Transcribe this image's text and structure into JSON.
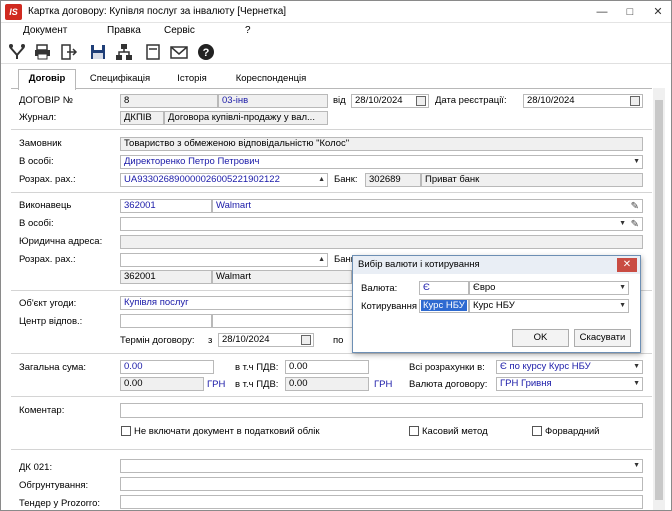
{
  "window": {
    "title": "Картка договору:  Купівля послуг за інвалюту [Чернетка]"
  },
  "menu": [
    "Документ",
    "Правка",
    "Сервіс",
    "?"
  ],
  "tabs": [
    "Договір",
    "Специфікація",
    "Історія",
    "Кореспонденція"
  ],
  "contract": {
    "label_no": "ДОГОВІР №",
    "number": "8",
    "date_text": "03-інв",
    "label_from": "від",
    "date": "28/10/2024",
    "label_reg": "Дата реєстрації:",
    "reg_date": "28/10/2024",
    "label_journal": "Журнал:",
    "journal_code": "ДКПІВ",
    "journal_name": "Договора купівлі-продажу у вал..."
  },
  "customer": {
    "label": "Замовник",
    "name": "Товариство з обмеженою відповідальністю \"Колос\"",
    "label_person": "В особі:",
    "person": "Директоренко Петро Петрович",
    "label_account": "Розрах. рах.:",
    "account": "UA933026890000026005221902122",
    "label_bank": "Банк:",
    "bank_code": "302689",
    "bank_name": "Приват банк"
  },
  "executor": {
    "label": "Виконавець",
    "code": "362001",
    "name": "Walmart",
    "label_person": "В особі:",
    "label_address": "Юридична адреса:",
    "label_account": "Розрах. рах.:",
    "label_bank": "Банк",
    "bank_code": "362001",
    "bank_name": "Walmart"
  },
  "subject": {
    "label": "Об'єкт угоди:",
    "value": "Купівля послуг",
    "label_center": "Центр відпов.:",
    "label_term": "Термін договору:",
    "label_term_from": "з",
    "term_from": "28/10/2024",
    "label_term_to": "по"
  },
  "sums": {
    "label_total": "Загальна сума:",
    "total": "0.00",
    "label_vat": "в т.ч ПДВ:",
    "vat": "0.00",
    "total2": "0.00",
    "cur1": "ГРН",
    "vat2": "0.00",
    "cur2": "ГРН",
    "label_settlements": "Всі розрахунки в:",
    "settlements": "Є по курсу Курс НБУ",
    "label_currency": "Валюта договору:",
    "currency": "ГРН Гривня"
  },
  "comment": {
    "label": "Коментар:"
  },
  "checkboxes": {
    "no_tax": "Не включати документ в податковий облік",
    "cash": "Касовий метод",
    "forward": "Форвардний"
  },
  "bottom": {
    "dk": "ДК 021:",
    "justification": "Обгрунтування:",
    "tender": "Тендер у Prozorro:"
  },
  "dialog": {
    "title": "Вибір валюти і котирування",
    "label_currency": "Валюта:",
    "currency_code": "Є",
    "currency_name": "Євро",
    "label_quote": "Котирування",
    "quote_code": "Курс НБУ",
    "quote_name": "Курс НБУ",
    "ok": "OK",
    "cancel": "Скасувати"
  },
  "icons": [
    "filter-icon",
    "print-icon",
    "exit-icon",
    "save-icon",
    "tree-icon",
    "form-icon",
    "mail-icon",
    "help-icon"
  ]
}
